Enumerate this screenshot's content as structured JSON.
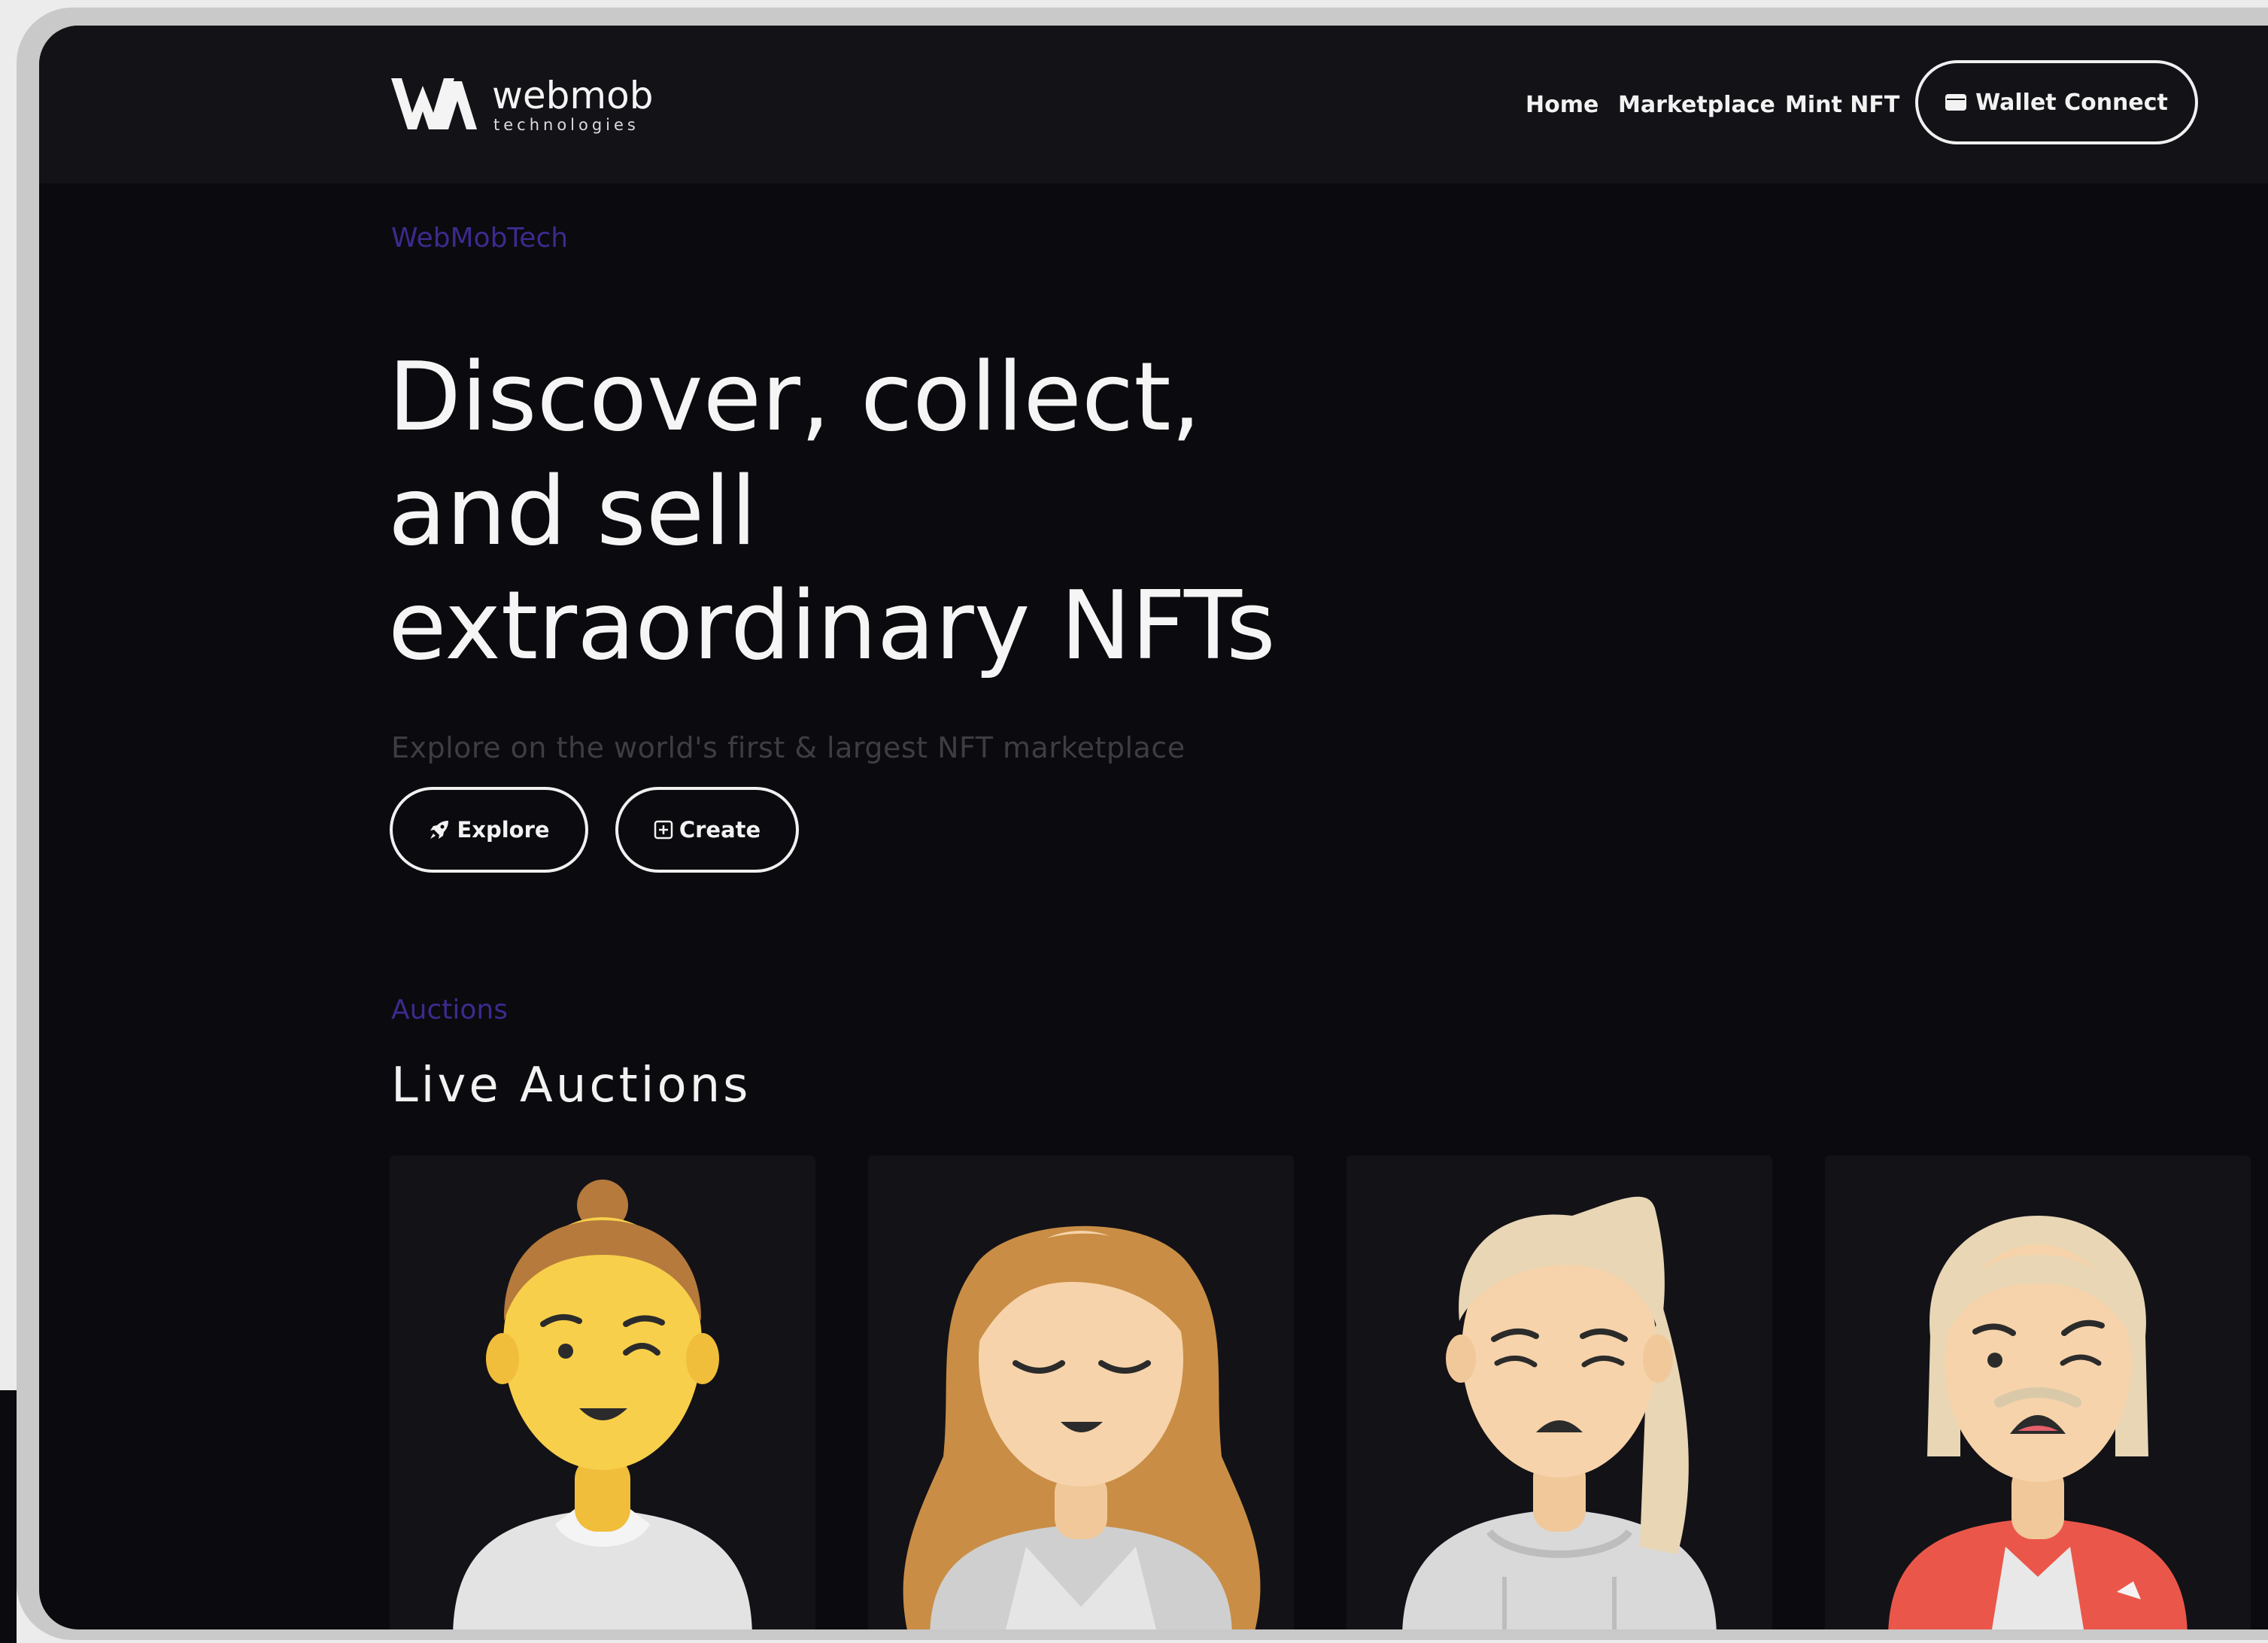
{
  "brand": {
    "name": "webmob",
    "tagline": "technologies"
  },
  "nav": {
    "links": [
      "Home",
      "Marketplace",
      "Mint NFT"
    ],
    "wallet_button": "Wallet Connect",
    "wallet_icon": "wallet-icon"
  },
  "hero": {
    "eyebrow": "WebMobTech",
    "title_lines": [
      "Discover, collect,",
      "and sell",
      "extraordinary NFTs"
    ],
    "subtitle": "Explore on the world's first & largest NFT marketplace",
    "buttons": [
      {
        "label": "Explore",
        "icon": "rocket-icon"
      },
      {
        "label": "Create",
        "icon": "plus-square-icon"
      }
    ]
  },
  "auctions": {
    "eyebrow": "Auctions",
    "title": "Live Auctions",
    "cards": [
      {
        "avatar": "winking-avatar"
      },
      {
        "avatar": "calm-avatar"
      },
      {
        "avatar": "worried-avatar"
      },
      {
        "avatar": "scared-avatar"
      }
    ]
  },
  "colors": {
    "background": "#0b0a0e",
    "navbar": "#131217",
    "accent": "#3d2a8e",
    "text": "#f5f5f5",
    "muted": "#3e3d44"
  }
}
